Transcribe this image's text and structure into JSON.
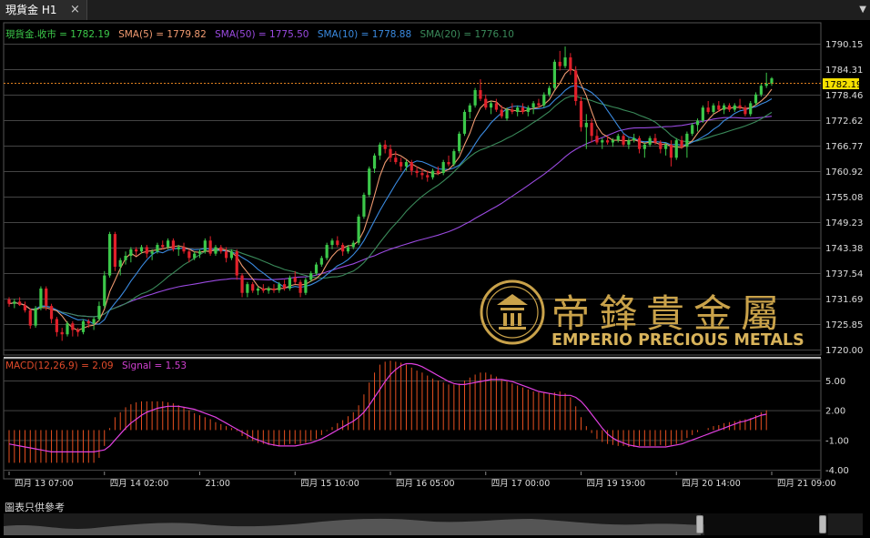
{
  "tab": {
    "label": "現貨金 H1",
    "close_glyph": "×",
    "menu_glyph": "▼"
  },
  "legend": [
    {
      "text": "現貨金.收市 = 1782.19",
      "color": "#3cc84a"
    },
    {
      "text": "SMA(5) = 1779.82",
      "color": "#f09a70"
    },
    {
      "text": "SMA(50) = 1775.50",
      "color": "#9a4ae0"
    },
    {
      "text": "SMA(10) = 1778.88",
      "color": "#3a8ae0"
    },
    {
      "text": "SMA(20) = 1776.10",
      "color": "#3a8a5a"
    }
  ],
  "macd_legend": {
    "text": "MACD(12,26,9) = 2.09",
    "signal_text": "Signal = 1.53",
    "color": "#e04a2a",
    "signal_color": "#d040d0"
  },
  "price_badge": "1782.19",
  "watermark": {
    "chinese": "帝鋒貴金屬",
    "english": "EMPERIO PRECIOUS METALS"
  },
  "disclaimer": "圖表只供參考",
  "colors": {
    "up": "#3cc84a",
    "down": "#e0202a",
    "grid": "#444444",
    "badge": "#f5e000",
    "macd_hist": "#e85020",
    "signal": "#e040e0",
    "gold": "#c9a24a"
  },
  "chart_data": [
    {
      "type": "candlestick",
      "title": "現貨金 H1",
      "y_ticks": [
        "1790.15",
        "1784.31",
        "1778.46",
        "1772.62",
        "1766.77",
        "1760.92",
        "1755.08",
        "1749.23",
        "1743.38",
        "1737.54",
        "1731.69",
        "1725.85",
        "1720.00"
      ],
      "ylim": [
        1720.0,
        1790.15
      ],
      "x_ticks": [
        "四月 13 07:00",
        "四月 14 02:00",
        "21:00",
        "四月 15 10:00",
        "四月 16 05:00",
        "四月 17 00:00",
        "四月 19 19:00",
        "四月 20 14:00",
        "四月 21 09:00"
      ],
      "last_close": 1782.19,
      "ohlc": [
        [
          1731.5,
          1732.0,
          1729.8,
          1730.5
        ],
        [
          1730.5,
          1731.6,
          1729.5,
          1731.0
        ],
        [
          1731.0,
          1732.0,
          1730.0,
          1730.2
        ],
        [
          1730.2,
          1731.0,
          1728.5,
          1729.0
        ],
        [
          1729.0,
          1729.5,
          1724.8,
          1725.5
        ],
        [
          1725.5,
          1730.0,
          1725.0,
          1729.5
        ],
        [
          1729.5,
          1734.5,
          1729.0,
          1734.0
        ],
        [
          1734.0,
          1734.5,
          1729.0,
          1730.0
        ],
        [
          1730.0,
          1730.5,
          1726.0,
          1727.0
        ],
        [
          1727.0,
          1727.5,
          1723.0,
          1724.0
        ],
        [
          1724.0,
          1725.0,
          1722.0,
          1723.5
        ],
        [
          1723.5,
          1726.5,
          1723.0,
          1726.0
        ],
        [
          1726.0,
          1726.5,
          1723.0,
          1724.5
        ],
        [
          1724.5,
          1725.0,
          1723.0,
          1724.0
        ],
        [
          1724.0,
          1727.0,
          1723.5,
          1726.5
        ],
        [
          1726.5,
          1727.0,
          1725.0,
          1726.0
        ],
        [
          1726.0,
          1727.5,
          1724.5,
          1727.0
        ],
        [
          1727.0,
          1731.0,
          1726.5,
          1730.0
        ],
        [
          1730.0,
          1738.0,
          1729.5,
          1737.0
        ],
        [
          1737.0,
          1747.0,
          1736.5,
          1746.5
        ],
        [
          1746.5,
          1747.0,
          1738.0,
          1739.0
        ],
        [
          1739.0,
          1741.0,
          1737.0,
          1740.5
        ],
        [
          1740.5,
          1742.5,
          1739.5,
          1741.5
        ],
        [
          1741.5,
          1743.5,
          1740.0,
          1743.0
        ],
        [
          1743.0,
          1743.5,
          1741.5,
          1742.5
        ],
        [
          1742.5,
          1744.0,
          1742.0,
          1743.5
        ],
        [
          1743.5,
          1744.0,
          1741.0,
          1742.0
        ],
        [
          1742.0,
          1743.0,
          1740.5,
          1742.5
        ],
        [
          1742.5,
          1744.5,
          1742.0,
          1744.0
        ],
        [
          1744.0,
          1745.0,
          1743.0,
          1743.5
        ],
        [
          1743.5,
          1745.5,
          1743.0,
          1745.0
        ],
        [
          1745.0,
          1745.5,
          1742.5,
          1743.0
        ],
        [
          1743.0,
          1744.0,
          1741.5,
          1743.5
        ],
        [
          1743.5,
          1744.5,
          1742.0,
          1742.5
        ],
        [
          1742.5,
          1743.0,
          1740.0,
          1741.0
        ],
        [
          1741.0,
          1742.5,
          1740.5,
          1742.0
        ],
        [
          1742.0,
          1743.0,
          1741.0,
          1742.5
        ],
        [
          1742.5,
          1745.5,
          1742.0,
          1745.0
        ],
        [
          1745.0,
          1746.0,
          1741.5,
          1742.0
        ],
        [
          1742.0,
          1744.0,
          1741.5,
          1743.5
        ],
        [
          1743.5,
          1744.0,
          1742.0,
          1742.5
        ],
        [
          1742.5,
          1743.5,
          1740.0,
          1741.0
        ],
        [
          1741.0,
          1743.0,
          1740.5,
          1742.5
        ],
        [
          1742.5,
          1743.0,
          1736.0,
          1737.0
        ],
        [
          1737.0,
          1737.5,
          1732.0,
          1733.0
        ],
        [
          1733.0,
          1735.5,
          1732.0,
          1735.0
        ],
        [
          1735.0,
          1735.5,
          1733.0,
          1733.5
        ],
        [
          1733.5,
          1734.5,
          1732.5,
          1734.0
        ],
        [
          1734.0,
          1735.0,
          1733.0,
          1733.5
        ],
        [
          1733.5,
          1734.5,
          1732.8,
          1734.0
        ],
        [
          1734.0,
          1735.0,
          1733.0,
          1733.6
        ],
        [
          1733.6,
          1735.5,
          1733.0,
          1735.0
        ],
        [
          1735.0,
          1736.0,
          1733.5,
          1734.0
        ],
        [
          1734.0,
          1737.0,
          1733.5,
          1736.5
        ],
        [
          1736.5,
          1738.0,
          1735.0,
          1735.5
        ],
        [
          1735.5,
          1736.0,
          1732.0,
          1733.0
        ],
        [
          1733.0,
          1736.5,
          1732.5,
          1736.0
        ],
        [
          1736.0,
          1738.0,
          1735.5,
          1737.5
        ],
        [
          1737.5,
          1740.0,
          1737.0,
          1739.5
        ],
        [
          1739.5,
          1741.5,
          1739.0,
          1741.0
        ],
        [
          1741.0,
          1744.5,
          1740.5,
          1744.0
        ],
        [
          1744.0,
          1745.5,
          1743.0,
          1745.0
        ],
        [
          1745.0,
          1746.0,
          1743.5,
          1744.0
        ],
        [
          1744.0,
          1744.5,
          1741.5,
          1742.5
        ],
        [
          1742.5,
          1744.0,
          1742.0,
          1743.5
        ],
        [
          1743.5,
          1745.0,
          1743.0,
          1744.5
        ],
        [
          1744.5,
          1751.0,
          1744.0,
          1750.5
        ],
        [
          1750.5,
          1756.0,
          1750.0,
          1755.5
        ],
        [
          1755.5,
          1762.0,
          1755.0,
          1761.5
        ],
        [
          1761.5,
          1765.0,
          1760.5,
          1764.5
        ],
        [
          1764.5,
          1767.5,
          1763.5,
          1767.0
        ],
        [
          1767.0,
          1768.0,
          1765.0,
          1766.0
        ],
        [
          1766.0,
          1767.0,
          1763.0,
          1764.0
        ],
        [
          1764.0,
          1765.5,
          1762.5,
          1763.0
        ],
        [
          1763.0,
          1764.0,
          1761.0,
          1762.0
        ],
        [
          1762.0,
          1763.5,
          1761.0,
          1763.0
        ],
        [
          1763.0,
          1763.5,
          1760.0,
          1761.0
        ],
        [
          1761.0,
          1762.0,
          1759.5,
          1760.5
        ],
        [
          1760.5,
          1761.5,
          1759.0,
          1760.0
        ],
        [
          1760.0,
          1761.0,
          1758.5,
          1759.5
        ],
        [
          1759.5,
          1761.5,
          1759.0,
          1761.0
        ],
        [
          1761.0,
          1762.0,
          1760.0,
          1760.5
        ],
        [
          1760.5,
          1763.5,
          1760.0,
          1763.0
        ],
        [
          1763.0,
          1764.5,
          1762.0,
          1762.5
        ],
        [
          1762.5,
          1766.0,
          1762.0,
          1765.5
        ],
        [
          1765.5,
          1770.0,
          1765.0,
          1769.5
        ],
        [
          1769.5,
          1775.0,
          1769.0,
          1774.5
        ],
        [
          1774.5,
          1776.5,
          1773.0,
          1776.0
        ],
        [
          1776.0,
          1780.0,
          1775.5,
          1779.5
        ],
        [
          1779.5,
          1782.0,
          1777.0,
          1777.5
        ],
        [
          1777.5,
          1778.5,
          1775.0,
          1775.5
        ],
        [
          1775.5,
          1777.0,
          1774.0,
          1776.5
        ],
        [
          1776.5,
          1777.5,
          1774.5,
          1775.0
        ],
        [
          1775.0,
          1776.0,
          1773.0,
          1773.5
        ],
        [
          1773.0,
          1775.5,
          1772.5,
          1775.0
        ],
        [
          1775.0,
          1776.5,
          1774.0,
          1774.5
        ],
        [
          1774.5,
          1776.0,
          1773.5,
          1775.5
        ],
        [
          1775.5,
          1776.5,
          1774.0,
          1774.5
        ],
        [
          1774.5,
          1776.0,
          1773.5,
          1775.5
        ],
        [
          1775.5,
          1777.0,
          1774.0,
          1776.5
        ],
        [
          1776.5,
          1777.5,
          1775.5,
          1776.0
        ],
        [
          1776.0,
          1779.0,
          1775.5,
          1778.5
        ],
        [
          1778.5,
          1780.5,
          1778.0,
          1780.0
        ],
        [
          1780.0,
          1786.5,
          1779.5,
          1786.0
        ],
        [
          1786.0,
          1788.5,
          1784.0,
          1785.0
        ],
        [
          1785.0,
          1789.5,
          1784.5,
          1787.0
        ],
        [
          1787.0,
          1788.0,
          1783.0,
          1784.0
        ],
        [
          1784.0,
          1785.0,
          1776.0,
          1777.0
        ],
        [
          1777.0,
          1778.0,
          1770.0,
          1771.0
        ],
        [
          1771.0,
          1774.0,
          1766.0,
          1772.0
        ],
        [
          1772.0,
          1773.0,
          1767.5,
          1769.0
        ],
        [
          1769.0,
          1770.5,
          1767.0,
          1767.5
        ],
        [
          1767.5,
          1768.5,
          1766.0,
          1768.0
        ],
        [
          1768.0,
          1769.0,
          1767.0,
          1767.5
        ],
        [
          1767.5,
          1768.5,
          1766.5,
          1768.0
        ],
        [
          1768.0,
          1769.5,
          1767.5,
          1769.0
        ],
        [
          1769.0,
          1769.5,
          1766.5,
          1767.0
        ],
        [
          1767.0,
          1768.5,
          1766.0,
          1768.0
        ],
        [
          1768.0,
          1769.5,
          1767.5,
          1768.5
        ],
        [
          1768.5,
          1769.0,
          1765.0,
          1766.0
        ],
        [
          1766.0,
          1767.5,
          1764.0,
          1767.0
        ],
        [
          1767.0,
          1769.0,
          1766.5,
          1768.5
        ],
        [
          1768.5,
          1769.5,
          1767.0,
          1767.5
        ],
        [
          1767.5,
          1768.0,
          1765.0,
          1766.0
        ],
        [
          1766.0,
          1767.5,
          1764.5,
          1767.0
        ],
        [
          1767.0,
          1768.0,
          1762.0,
          1764.0
        ],
        [
          1764.0,
          1768.5,
          1763.5,
          1768.0
        ],
        [
          1768.0,
          1769.0,
          1766.0,
          1766.5
        ],
        [
          1766.5,
          1770.0,
          1764.0,
          1769.5
        ],
        [
          1769.5,
          1772.0,
          1769.0,
          1771.5
        ],
        [
          1771.5,
          1773.0,
          1770.0,
          1772.5
        ],
        [
          1772.5,
          1776.0,
          1772.0,
          1775.5
        ],
        [
          1775.5,
          1777.0,
          1774.0,
          1774.5
        ],
        [
          1774.5,
          1776.5,
          1774.0,
          1776.0
        ],
        [
          1776.0,
          1777.0,
          1774.5,
          1775.0
        ],
        [
          1775.0,
          1776.5,
          1774.0,
          1776.0
        ],
        [
          1776.0,
          1776.5,
          1774.5,
          1775.0
        ],
        [
          1775.0,
          1776.5,
          1774.5,
          1776.0
        ],
        [
          1776.0,
          1777.5,
          1775.0,
          1775.5
        ],
        [
          1775.5,
          1776.0,
          1773.5,
          1774.0
        ],
        [
          1774.0,
          1777.0,
          1773.5,
          1776.5
        ],
        [
          1776.5,
          1779.0,
          1776.0,
          1778.5
        ],
        [
          1778.5,
          1781.0,
          1778.0,
          1780.5
        ],
        [
          1780.5,
          1783.5,
          1780.0,
          1781.0
        ],
        [
          1781.0,
          1782.5,
          1780.5,
          1782.19
        ]
      ]
    },
    {
      "type": "bar",
      "title": "MACD(12,26,9)",
      "y_ticks": [
        "5.00",
        "2.00",
        "-1.00",
        "-4.00"
      ],
      "ylim": [
        -4.0,
        5.0
      ],
      "values": [
        -3.3,
        -3.3,
        -3.3,
        -3.3,
        -3.3,
        -3.3,
        -3.3,
        -3.3,
        -3.3,
        -3.3,
        -3.3,
        -3.3,
        -3.3,
        -3.3,
        -3.3,
        -3.3,
        -3.3,
        -2.8,
        -1.6,
        0.2,
        1.3,
        1.8,
        2.3,
        2.6,
        2.8,
        2.9,
        2.9,
        2.9,
        2.9,
        2.9,
        2.8,
        2.7,
        2.5,
        2.3,
        2.0,
        1.7,
        1.5,
        1.3,
        1.1,
        0.8,
        0.6,
        0.4,
        0.2,
        -0.1,
        -0.6,
        -0.9,
        -1.1,
        -1.3,
        -1.4,
        -1.5,
        -1.6,
        -1.6,
        -1.5,
        -1.4,
        -1.4,
        -1.4,
        -1.3,
        -1.1,
        -0.9,
        -0.5,
        -0.1,
        0.3,
        0.7,
        1.0,
        1.4,
        1.8,
        2.5,
        3.6,
        4.8,
        5.8,
        6.6,
        6.9,
        7.0,
        6.9,
        6.8,
        6.6,
        6.3,
        6.0,
        5.8,
        5.5,
        5.2,
        5.0,
        4.8,
        4.6,
        4.6,
        4.7,
        5.0,
        5.3,
        5.6,
        5.8,
        5.8,
        5.6,
        5.4,
        5.1,
        4.9,
        4.7,
        4.5,
        4.3,
        4.1,
        3.9,
        3.8,
        3.8,
        3.7,
        3.8,
        3.9,
        3.7,
        3.3,
        2.4,
        1.3,
        0.4,
        -0.3,
        -0.9,
        -1.2,
        -1.4,
        -1.5,
        -1.6,
        -1.6,
        -1.7,
        -1.7,
        -1.6,
        -1.6,
        -1.6,
        -1.6,
        -1.5,
        -1.6,
        -1.5,
        -1.4,
        -1.1,
        -0.8,
        -0.5,
        -0.2,
        0.0,
        0.2,
        0.4,
        0.5,
        0.7,
        0.8,
        0.9,
        1.0,
        1.1,
        1.2,
        1.5,
        1.8,
        2.0
      ],
      "signal": [
        -1.4,
        -1.5,
        -1.6,
        -1.7,
        -1.8,
        -1.9,
        -2.0,
        -2.1,
        -2.2,
        -2.2,
        -2.2,
        -2.2,
        -2.2,
        -2.2,
        -2.2,
        -2.2,
        -2.2,
        -2.1,
        -2.0,
        -1.6,
        -1.0,
        -0.4,
        0.2,
        0.7,
        1.1,
        1.5,
        1.8,
        2.0,
        2.2,
        2.3,
        2.4,
        2.4,
        2.4,
        2.3,
        2.2,
        2.1,
        1.9,
        1.7,
        1.5,
        1.3,
        1.0,
        0.7,
        0.4,
        0.1,
        -0.2,
        -0.5,
        -0.8,
        -1.0,
        -1.2,
        -1.4,
        -1.5,
        -1.6,
        -1.6,
        -1.6,
        -1.6,
        -1.5,
        -1.4,
        -1.3,
        -1.1,
        -0.9,
        -0.6,
        -0.3,
        0.0,
        0.3,
        0.6,
        0.9,
        1.3,
        1.8,
        2.5,
        3.3,
        4.1,
        4.9,
        5.6,
        6.1,
        6.5,
        6.7,
        6.7,
        6.6,
        6.4,
        6.1,
        5.8,
        5.5,
        5.2,
        4.9,
        4.7,
        4.6,
        4.6,
        4.7,
        4.8,
        4.9,
        5.0,
        5.1,
        5.1,
        5.1,
        5.0,
        4.9,
        4.7,
        4.5,
        4.3,
        4.1,
        3.9,
        3.8,
        3.7,
        3.6,
        3.5,
        3.5,
        3.5,
        3.3,
        2.9,
        2.3,
        1.6,
        0.9,
        0.2,
        -0.4,
        -0.8,
        -1.1,
        -1.3,
        -1.5,
        -1.6,
        -1.7,
        -1.7,
        -1.7,
        -1.7,
        -1.7,
        -1.7,
        -1.6,
        -1.5,
        -1.4,
        -1.2,
        -1.0,
        -0.8,
        -0.6,
        -0.4,
        -0.2,
        0.0,
        0.2,
        0.4,
        0.6,
        0.8,
        0.9,
        1.1,
        1.3,
        1.5,
        1.6
      ],
      "macd_value": 2.09,
      "signal_value": 1.53
    }
  ]
}
